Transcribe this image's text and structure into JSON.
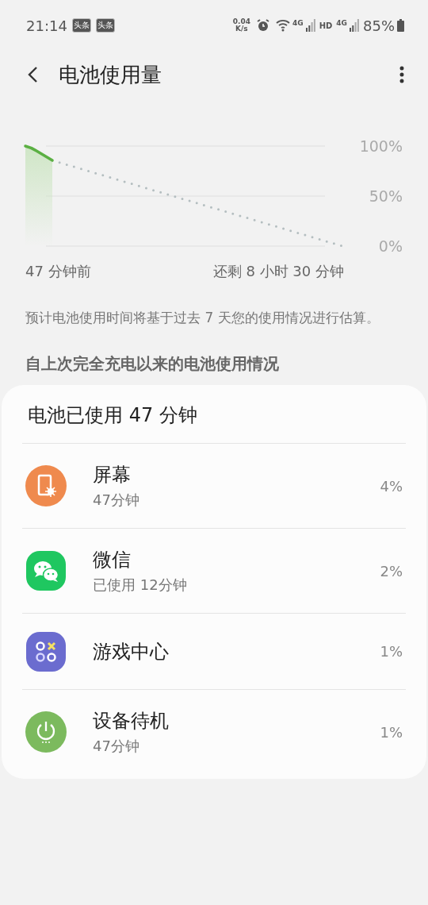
{
  "status_bar": {
    "time": "21:14",
    "notifications": [
      "头条",
      "头条"
    ],
    "net_speed": {
      "value": "0.04",
      "unit": "K/s"
    },
    "network_labels": [
      "4G",
      "HD",
      "4G"
    ],
    "battery": "85%"
  },
  "header": {
    "title": "电池使用量"
  },
  "chart": {
    "y_labels": [
      "100%",
      "50%",
      "0%"
    ],
    "x_labels": [
      "47 分钟前",
      "还剩 8 小时 30 分钟"
    ]
  },
  "note": "预计电池使用时间将基于过去 7 天您的使用情况进行估算。",
  "section_title": "自上次完全充电以来的电池使用情况",
  "usage": {
    "title": "电池已使用 47 分钟",
    "items": [
      {
        "kind": "screen",
        "color": "#ef8a4e",
        "name": "屏幕",
        "detail": "47分钟",
        "percent": "4%"
      },
      {
        "kind": "chat",
        "color": "#1fc760",
        "name": "微信",
        "detail": "已使用 12分钟",
        "percent": "2%"
      },
      {
        "kind": "game",
        "color": "#6b6ccf",
        "name": "游戏中心",
        "percent": "1%"
      },
      {
        "kind": "standby",
        "color": "#7cba5e",
        "name": "设备待机",
        "detail": "47分钟",
        "percent": "1%"
      }
    ]
  }
}
